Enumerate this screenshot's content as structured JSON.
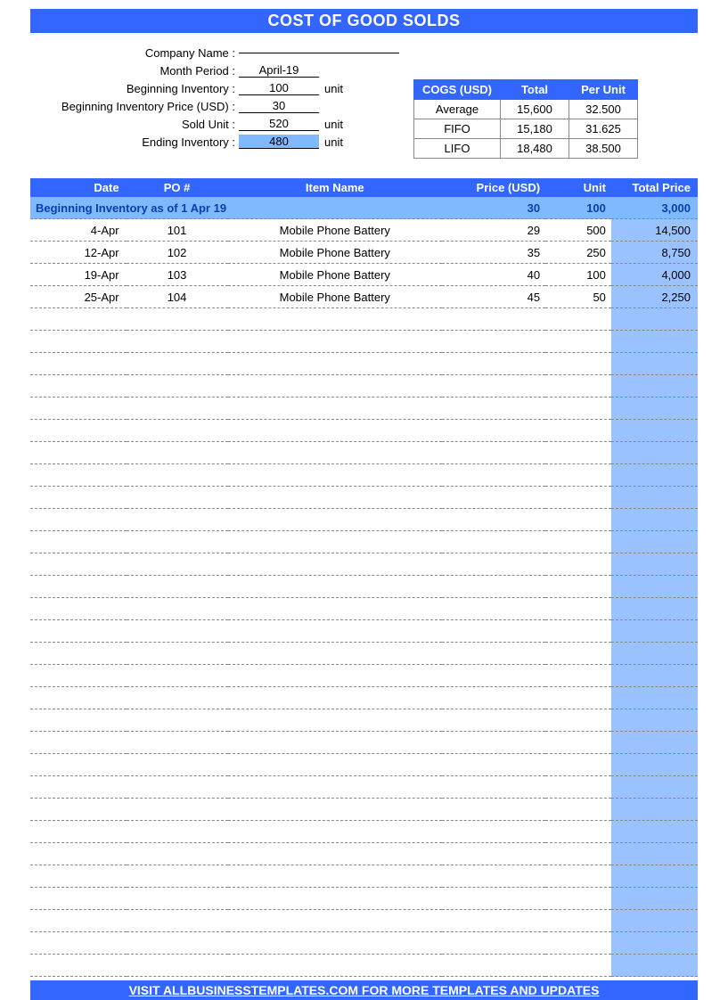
{
  "title": "COST OF GOOD SOLDS",
  "fields": {
    "company_name": {
      "label": "Company Name :",
      "value": ""
    },
    "month_period": {
      "label": "Month Period :",
      "value": "April-19"
    },
    "beg_inventory": {
      "label": "Beginning Inventory :",
      "value": "100",
      "unit": "unit"
    },
    "beg_inv_price": {
      "label": "Beginning Inventory Price (USD) :",
      "value": "30",
      "unit": ""
    },
    "sold_unit": {
      "label": "Sold Unit :",
      "value": "520",
      "unit": "unit"
    },
    "ending_inventory": {
      "label": "Ending Inventory :",
      "value": "480",
      "unit": "unit"
    }
  },
  "cogs": {
    "headers": {
      "method": "COGS (USD)",
      "total": "Total",
      "per_unit": "Per Unit"
    },
    "rows": [
      {
        "method": "Average",
        "total": "15,600",
        "per_unit": "32.500"
      },
      {
        "method": "FIFO",
        "total": "15,180",
        "per_unit": "31.625"
      },
      {
        "method": "LIFO",
        "total": "18,480",
        "per_unit": "38.500"
      }
    ]
  },
  "table": {
    "headers": {
      "date": "Date",
      "po": "PO #",
      "item": "Item Name",
      "price": "Price (USD)",
      "unit": "Unit",
      "total": "Total Price"
    },
    "beginning_row": {
      "label": "Beginning Inventory as of  1 Apr 19",
      "price": "30",
      "unit": "100",
      "total": "3,000"
    },
    "rows": [
      {
        "date": "4-Apr",
        "po": "101",
        "item": "Mobile Phone Battery",
        "price": "29",
        "unit": "500",
        "total": "14,500"
      },
      {
        "date": "12-Apr",
        "po": "102",
        "item": "Mobile Phone Battery",
        "price": "35",
        "unit": "250",
        "total": "8,750"
      },
      {
        "date": "19-Apr",
        "po": "103",
        "item": "Mobile Phone Battery",
        "price": "40",
        "unit": "100",
        "total": "4,000"
      },
      {
        "date": "25-Apr",
        "po": "104",
        "item": "Mobile Phone Battery",
        "price": "45",
        "unit": "50",
        "total": "2,250"
      }
    ],
    "empty_rows": 30
  },
  "footer": "VISIT ALLBUSINESSTEMPLATES.COM FOR MORE TEMPLATES AND UPDATES"
}
